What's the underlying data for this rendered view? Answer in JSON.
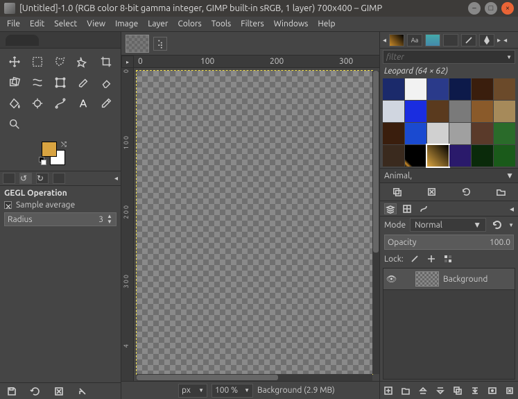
{
  "window": {
    "title": "[Untitled]-1.0 (RGB color 8-bit gamma integer, GIMP built-in sRGB, 1 layer) 700x400 – GIMP"
  },
  "menu": [
    "File",
    "Edit",
    "Select",
    "View",
    "Image",
    "Layer",
    "Colors",
    "Tools",
    "Filters",
    "Windows",
    "Help"
  ],
  "toolbox": {
    "tools": [
      "move",
      "rect-select",
      "free-select",
      "fuzzy-select",
      "crop",
      "rotate",
      "warp",
      "unified-transform",
      "paintbrush",
      "eraser",
      "bucket",
      "smudge",
      "paths",
      "text",
      "color-picker",
      "zoom"
    ],
    "fg_color": "#d9a441",
    "bg_color": "#ffffff"
  },
  "tool_options": {
    "title": "GEGL Operation",
    "sample_average_label": "Sample average",
    "sample_average_checked": false,
    "radius_label": "Radius",
    "radius_value": "3"
  },
  "ruler_h": [
    {
      "pos": 6,
      "label": "0"
    },
    {
      "pos": 96,
      "label": "100"
    },
    {
      "pos": 196,
      "label": "200"
    },
    {
      "pos": 296,
      "label": "300"
    }
  ],
  "ruler_v": [
    {
      "pos": 2,
      "label": "0"
    },
    {
      "pos": 98,
      "label": "1 0 0"
    },
    {
      "pos": 198,
      "label": "2 0 0"
    },
    {
      "pos": 298,
      "label": "3 0 0"
    },
    {
      "pos": 398,
      "label": "4"
    }
  ],
  "status": {
    "unit": "px",
    "zoom": "100 %",
    "message": "Background (2.9 MB)"
  },
  "patterns": {
    "filter_placeholder": "filter",
    "selected_name": "Leopard (64 × 62)",
    "category": "Animal,",
    "swatches": [
      "#1b2a6b",
      "#f2f2f2",
      "#2a3a8a",
      "#0d1a4a",
      "#3a1e0d",
      "#6b4a2a",
      "#d0d6e0",
      "#1a2de0",
      "#5a3a1e",
      "#7a7a7a",
      "#8a5a2a",
      "#a68a5a",
      "#3a1e0d",
      "#1a4ad0",
      "#d0d0d0",
      "#a0a0a0",
      "#5a3a2a",
      "#2a6b2a",
      "#3a2a1e",
      "linear-gradient(45deg,#000,#c98a2a 4px,#000 8px)",
      "linear-gradient(45deg,#d9a441,#000)",
      "#2a1a6b",
      "#0a2a0a",
      "#1a5a1a"
    ]
  },
  "layers": {
    "mode_label": "Mode",
    "mode_value": "Normal",
    "opacity_label": "Opacity",
    "opacity_value": "100.0",
    "lock_label": "Lock:",
    "items": [
      {
        "name": "Background",
        "visible": true
      }
    ]
  }
}
